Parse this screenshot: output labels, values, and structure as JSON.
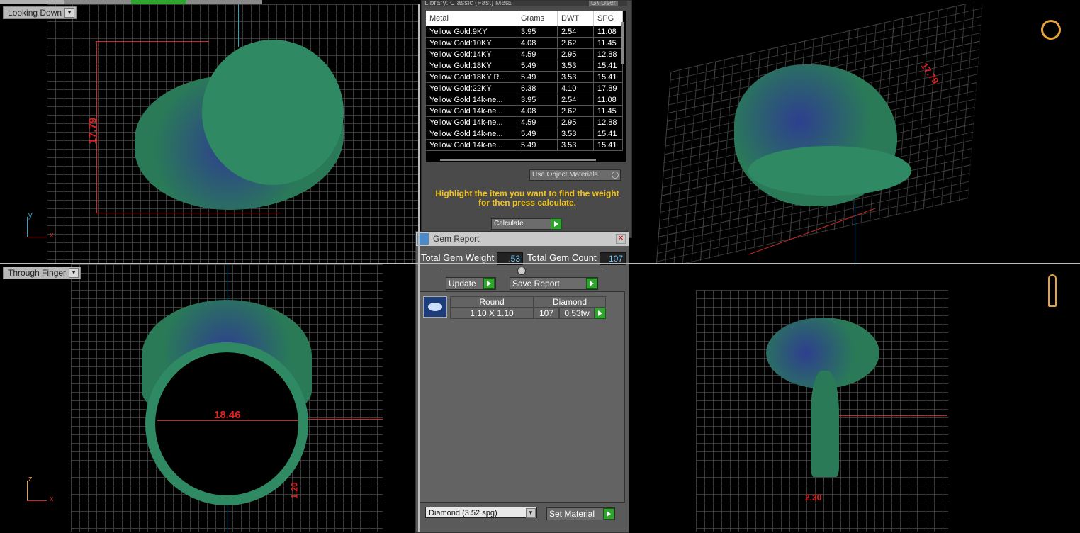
{
  "top_tabs": [
    "Looking Down",
    "",
    "",
    "",
    ""
  ],
  "viewports": {
    "top_left": {
      "label": "Looking Down",
      "dimension": "17.79",
      "axis_a": "y",
      "axis_b": "x"
    },
    "top_right": {
      "dimension": "17.79"
    },
    "bottom_left": {
      "label": "Through Finger",
      "dimension": "18.46",
      "dimension_small": "1.20",
      "axis_a": "z",
      "axis_b": "x"
    },
    "bottom_right": {
      "dimension": "2.30"
    }
  },
  "metal_panel": {
    "header_text": "Library: Classic (Fast) Metal",
    "header_buttons": [
      "GV",
      "User"
    ],
    "columns": [
      "Metal",
      "Grams",
      "DWT",
      "SPG"
    ],
    "rows": [
      [
        "Yellow Gold:9KY",
        "3.95",
        "2.54",
        "11.08"
      ],
      [
        "Yellow Gold:10KY",
        "4.08",
        "2.62",
        "11.45"
      ],
      [
        "Yellow Gold:14KY",
        "4.59",
        "2.95",
        "12.88"
      ],
      [
        "Yellow Gold:18KY",
        "5.49",
        "3.53",
        "15.41"
      ],
      [
        "Yellow Gold:18KY R...",
        "5.49",
        "3.53",
        "15.41"
      ],
      [
        "Yellow Gold:22KY",
        "6.38",
        "4.10",
        "17.89"
      ],
      [
        "Yellow Gold 14k-ne...",
        "3.95",
        "2.54",
        "11.08"
      ],
      [
        "Yellow Gold 14k-ne...",
        "4.08",
        "2.62",
        "11.45"
      ],
      [
        "Yellow Gold 14k-ne...",
        "4.59",
        "2.95",
        "12.88"
      ],
      [
        "Yellow Gold 14k-ne...",
        "5.49",
        "3.53",
        "15.41"
      ],
      [
        "Yellow Gold 14k-ne...",
        "5.49",
        "3.53",
        "15.41"
      ]
    ],
    "use_object_materials": "Use Object Materials",
    "hint": "Highlight the item you want to find the weight for then press calculate.",
    "calculate_label": "Calculate"
  },
  "gem_panel": {
    "title": "Gem Report",
    "total_weight_label": "Total Gem Weight",
    "total_weight_value": ".53",
    "total_count_label": "Total Gem Count",
    "total_count_value": "107",
    "update_label": "Update",
    "save_report_label": "Save Report",
    "row": {
      "shape": "Round",
      "material": "Diamond",
      "size": "1.10 X 1.10",
      "count": "107",
      "weight": "0.53tw"
    },
    "material_select": "Diamond    (3.52 spg)",
    "set_material_label": "Set Material"
  },
  "colors": {
    "accent_green": "#2fa52f",
    "hint_yellow": "#f2c21b",
    "value_blue": "#6ec6ff",
    "ring_green": "#2a7a58",
    "dimension_red": "#e02020"
  }
}
